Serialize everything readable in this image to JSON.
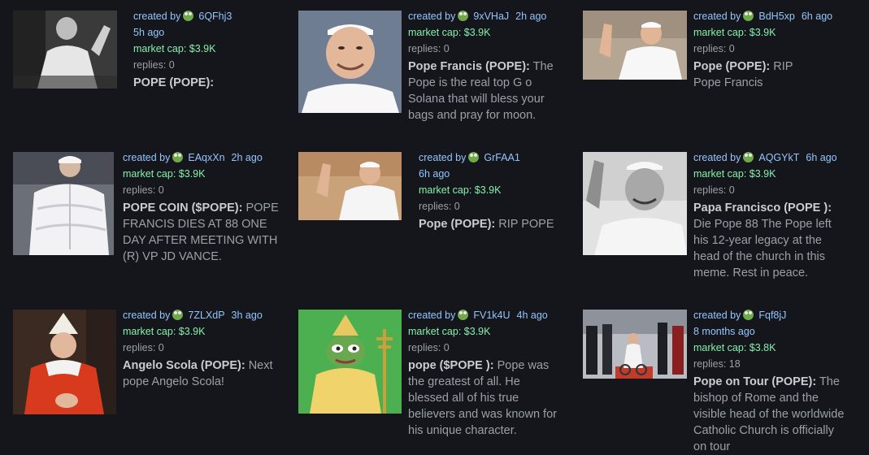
{
  "labels": {
    "created_by": "created by",
    "market_cap_prefix": "market cap:",
    "replies_prefix": "replies:"
  },
  "cards": [
    {
      "user": "6QFhj3",
      "time": "5h ago",
      "market_cap": "$3.9K",
      "replies": "0",
      "name": "POPE (POPE):",
      "description": "",
      "thumb": "bw-pope-waving"
    },
    {
      "user": "9xVHaJ",
      "time": "2h ago",
      "market_cap": "$3.9K",
      "replies": "0",
      "name": "Pope Francis (POPE):",
      "description": "The Pope is the real top G o Solana that will bless your bags and pray for moon.",
      "thumb": "pope-smiling-portrait"
    },
    {
      "user": "BdH5xp",
      "time": "6h ago",
      "market_cap": "$3.9K",
      "replies": "0",
      "name": "Pope (POPE):",
      "description": "RIP Pope Francis",
      "thumb": "pope-waving-smile"
    },
    {
      "user": "EAqxXn",
      "time": "2h ago",
      "market_cap": "$3.9K",
      "replies": "0",
      "name": "POPE COIN ($POPE):",
      "description": "POPE FRANCIS DIES AT 88 ONE DAY AFTER MEETING WITH (R) VP JD VANCE.",
      "thumb": "pope-puffer-jacket"
    },
    {
      "user": "GrFAA1",
      "time": "6h ago",
      "market_cap": "$3.9K",
      "replies": "0",
      "name": "Pope (POPE):",
      "description": "RIP POPE",
      "thumb": "pope-waving-warm"
    },
    {
      "user": "AQGYkT",
      "time": "6h ago",
      "market_cap": "$3.9K",
      "replies": "0",
      "name": "Papa Francisco (POPE ):",
      "description": "Die Pope 88 The Pope left his 12-year legacy at the head of the church in this meme. Rest in peace.",
      "thumb": "bw-pope-waving-close"
    },
    {
      "user": "7ZLXdP",
      "time": "3h ago",
      "market_cap": "$3.9K",
      "replies": "0",
      "name": "Angelo Scola (POPE):",
      "description": "Next pope Angelo Scola!",
      "thumb": "cardinal-red"
    },
    {
      "user": "FV1k4U",
      "time": "4h ago",
      "market_cap": "$3.9K",
      "replies": "0",
      "name": "pope ($POPE ):",
      "description": "Pope was the greatest of all. He blessed all of his true believers and was known for his unique character.",
      "thumb": "pepe-pope"
    },
    {
      "user": "Fqf8jJ",
      "time": "8 months ago",
      "market_cap": "$3.8K",
      "replies": "18",
      "name": "Pope on Tour (POPE):",
      "description": "The bishop of Rome and the visible head of the worldwide Catholic Church is officially on tour",
      "thumb": "pope-wheelchair-crowd"
    }
  ]
}
